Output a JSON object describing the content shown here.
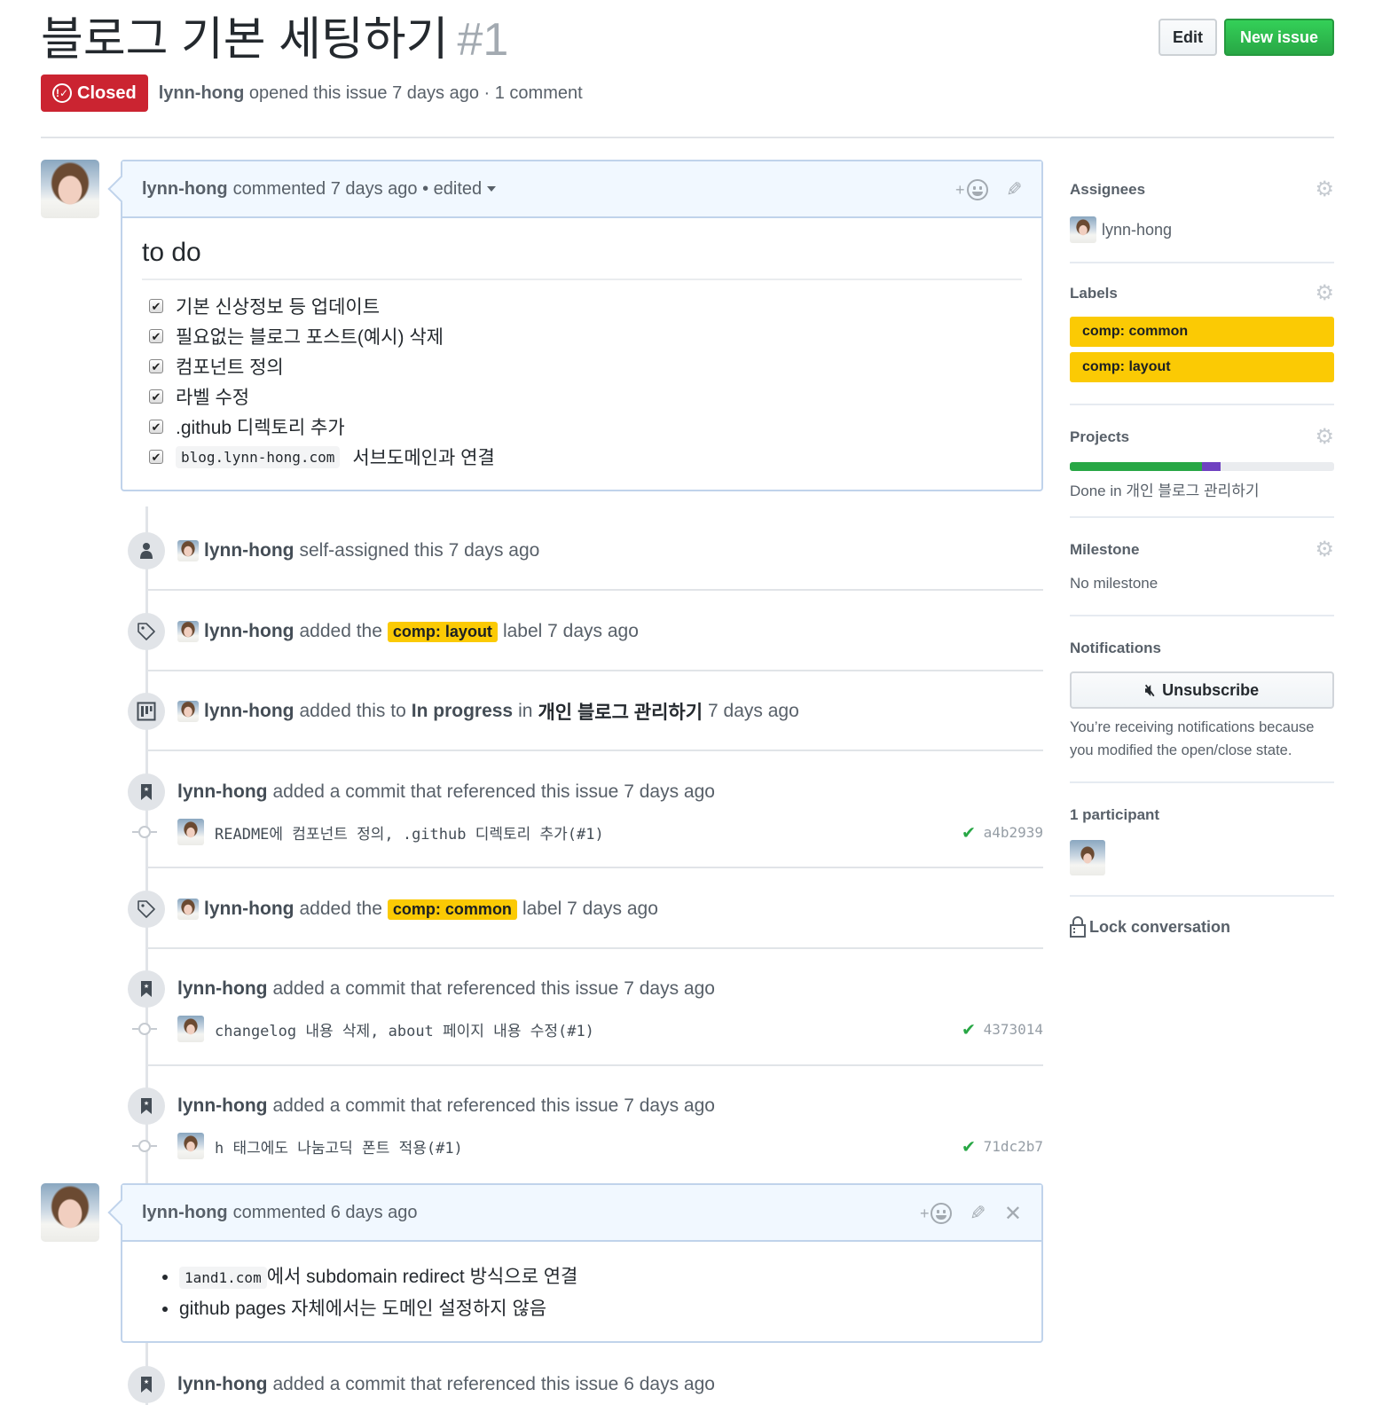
{
  "issue": {
    "title": "블로그 기본 세팅하기",
    "number": "#1",
    "state": "Closed",
    "author": "lynn-hong",
    "opened_text": "opened this issue 7 days ago · 1 comment"
  },
  "header_buttons": {
    "edit": "Edit",
    "new_issue": "New issue"
  },
  "comments": [
    {
      "author": "lynn-hong",
      "meta": "commented 7 days ago • edited",
      "heading": "to do",
      "tasks": [
        {
          "checked": true,
          "text": "기본 신상정보 등 업데이트"
        },
        {
          "checked": true,
          "text": "필요없는 블로그 포스트(예시) 삭제"
        },
        {
          "checked": true,
          "text": "컴포넌트 정의"
        },
        {
          "checked": true,
          "text": "라벨 수정"
        },
        {
          "checked": true,
          "text": ".github 디렉토리 추가"
        },
        {
          "checked": true,
          "code": "blog.lynn-hong.com",
          "text": "서브도메인과 연결"
        }
      ]
    },
    {
      "author": "lynn-hong",
      "meta": "commented 6 days ago",
      "bullets": [
        {
          "code": "1and1.com",
          "text": "에서 subdomain redirect 방식으로 연결"
        },
        {
          "text": "github pages 자체에서는 도메인 설정하지 않음"
        }
      ]
    }
  ],
  "timeline": [
    {
      "icon": "person-icon",
      "actor": "lynn-hong",
      "text": "self-assigned this 7 days ago"
    },
    {
      "icon": "tag-icon",
      "actor": "lynn-hong",
      "pre": "added the",
      "label": "comp: layout",
      "post": "label 7 days ago"
    },
    {
      "icon": "project-icon",
      "actor": "lynn-hong",
      "pre": "added this to",
      "column": "In progress",
      "mid": "in",
      "project": "개인 블로그 관리하기",
      "post": "7 days ago"
    },
    {
      "icon": "bookmark-icon",
      "actor": "lynn-hong",
      "text": "added a commit that referenced this issue 7 days ago",
      "commit": {
        "message": "README에 컴포넌트 정의, .github 디렉토리 추가(#1)",
        "sha": "a4b2939",
        "status": "success"
      }
    },
    {
      "icon": "tag-icon",
      "actor": "lynn-hong",
      "pre": "added the",
      "label": "comp: common",
      "post": "label 7 days ago"
    },
    {
      "icon": "bookmark-icon",
      "actor": "lynn-hong",
      "text": "added a commit that referenced this issue 7 days ago",
      "commit": {
        "message": "changelog 내용 삭제, about 페이지 내용 수정(#1)",
        "sha": "4373014",
        "status": "success"
      }
    },
    {
      "icon": "bookmark-icon",
      "actor": "lynn-hong",
      "text": "added a commit that referenced this issue 7 days ago",
      "commit": {
        "message": "h 태그에도 나눔고딕 폰트 적용(#1)",
        "sha": "71dc2b7",
        "status": "success"
      }
    },
    {
      "icon": "bookmark-icon",
      "actor": "lynn-hong",
      "text": "added a commit that referenced this issue 6 days ago"
    }
  ],
  "sidebar": {
    "assignees": {
      "title": "Assignees",
      "user": "lynn-hong"
    },
    "labels": {
      "title": "Labels",
      "items": [
        "comp: common",
        "comp: layout"
      ],
      "color": "#fbca04"
    },
    "projects": {
      "title": "Projects",
      "status_text": "Done in 개인 블로그 관리하기",
      "done_percent": 50,
      "in_progress_percent": 7
    },
    "milestone": {
      "title": "Milestone",
      "value": "No milestone"
    },
    "notifications": {
      "title": "Notifications",
      "button": "Unsubscribe",
      "reason": "You’re receiving notifications because you modified the open/close state."
    },
    "participants": {
      "title": "1 participant"
    },
    "lock": "Lock conversation"
  },
  "colors": {
    "closed": "#cb2431",
    "primary_button": "#28a745",
    "label_yellow": "#fbca04",
    "project_done": "#28a745",
    "project_in_progress": "#6f42c1",
    "commit_check": "#28a745"
  }
}
